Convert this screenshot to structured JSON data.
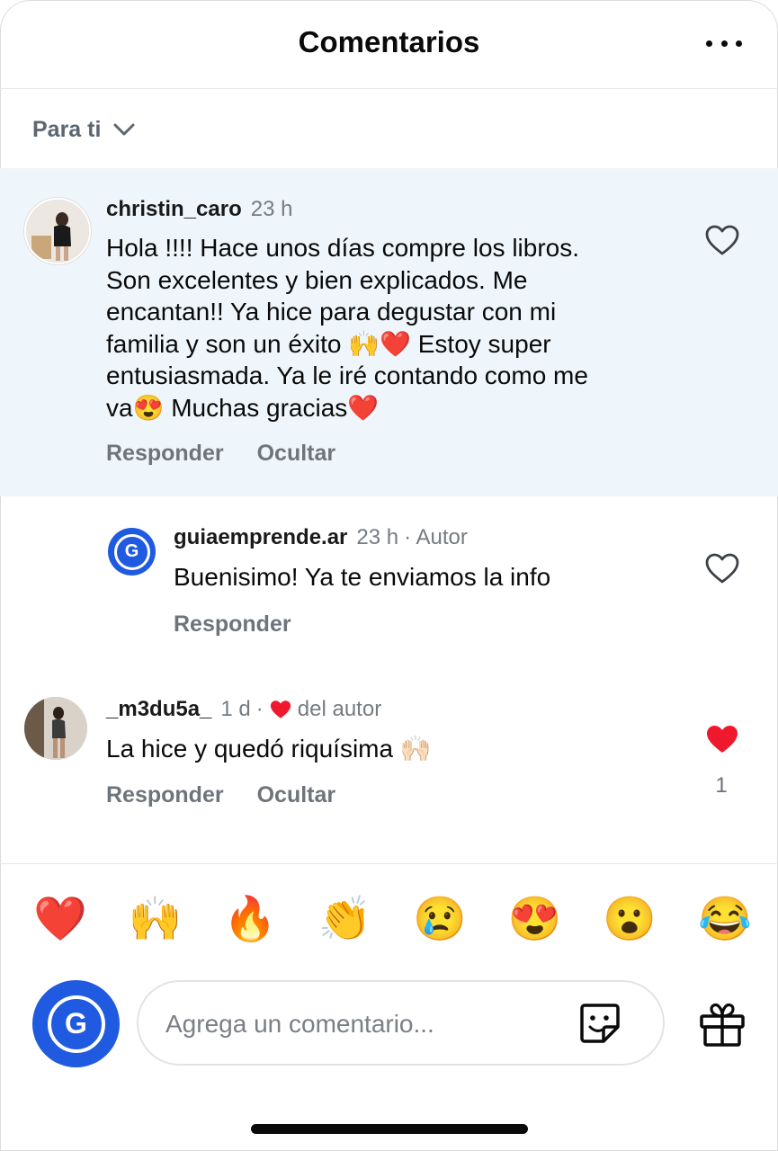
{
  "header": {
    "title": "Comentarios",
    "more_icon": "more-horizontal-icon"
  },
  "filter": {
    "label": "Para ti",
    "icon": "chevron-down-icon"
  },
  "comments": [
    {
      "username": "christin_caro",
      "time": "23 h",
      "text_lines": [
        "Hola !!!! Hace unos días compre los libros.",
        "Son excelentes y bien explicados. Me",
        "encantan!! Ya hice para degustar con mi",
        "familia y son un éxito 🙌❤️ Estoy super",
        "entusiasmada. Ya le iré contando como me",
        "va😍 Muchas gracias❤️"
      ],
      "reply_label": "Responder",
      "hide_label": "Ocultar",
      "liked": false
    },
    {
      "username": "guiaemprende.ar",
      "time": "23 h",
      "author_tag": "· Autor",
      "text": "Buenisimo! Ya te enviamos la info",
      "reply_label": "Responder",
      "avatar_letter": "G",
      "liked": false
    },
    {
      "username": "_m3du5a_",
      "time": "1 d",
      "separator": "·",
      "author_like": "del autor",
      "text": "La hice y quedó riquísima 🙌🏻",
      "reply_label": "Responder",
      "hide_label": "Ocultar",
      "liked": true,
      "like_count": "1"
    }
  ],
  "emoji_bar": [
    "❤️",
    "🙌",
    "🔥",
    "👏",
    "😢",
    "😍",
    "😮",
    "😂"
  ],
  "composer": {
    "placeholder": "Agrega un comentario...",
    "avatar_letter": "G",
    "sticker_icon": "sticker-icon",
    "gift_icon": "gift-icon"
  },
  "colors": {
    "accent_blue": "#1f5ae0",
    "like_red": "#f0182c",
    "highlight_bg": "#eff6fb"
  }
}
